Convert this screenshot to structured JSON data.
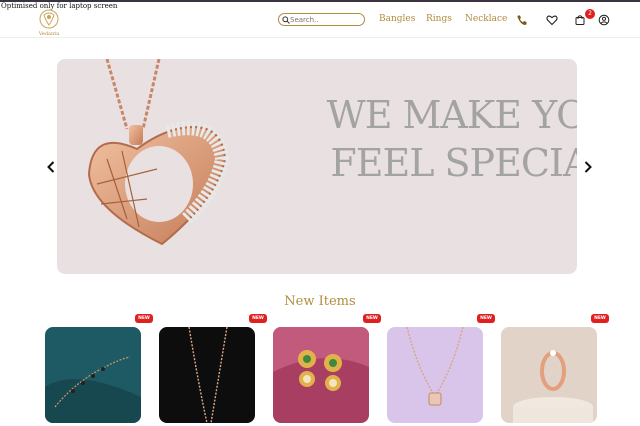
{
  "notice": "Optimised only for laptop screen",
  "brand": {
    "logo_text": "Vedanta"
  },
  "search": {
    "placeholder": "Search.."
  },
  "nav": {
    "links": [
      "Bangles",
      "Rings",
      "Necklace"
    ]
  },
  "header_icons": [
    "phone-icon",
    "heart-icon",
    "bag-icon",
    "user-icon"
  ],
  "cart": {
    "count": "2"
  },
  "banner": {
    "line1": "WE MAKE YOU",
    "line2": "FEEL SPECIAL"
  },
  "section": {
    "title": "New Items"
  },
  "products": [
    {
      "badge": "NEW",
      "image": "bracelet"
    },
    {
      "badge": "NEW",
      "image": "chain"
    },
    {
      "badge": "NEW",
      "image": "earrings"
    },
    {
      "badge": "NEW",
      "image": "pendant-necklace"
    },
    {
      "badge": "NEW",
      "image": "ring"
    }
  ],
  "colors": {
    "accent": "#b08c3e",
    "badge": "#e0201e",
    "banner_bg": "#e9e1e1",
    "banner_text": "#a3a3a3"
  }
}
